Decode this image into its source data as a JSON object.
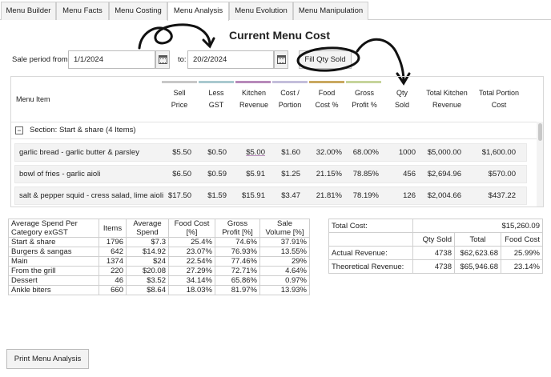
{
  "tabs": [
    {
      "label": "Menu Builder",
      "active": false
    },
    {
      "label": "Menu Facts",
      "active": false
    },
    {
      "label": "Menu Costing",
      "active": false
    },
    {
      "label": "Menu Analysis",
      "active": true
    },
    {
      "label": "Menu Evolution",
      "active": false
    },
    {
      "label": "Menu Manipulation",
      "active": false
    }
  ],
  "title": "Current Menu Cost",
  "period": {
    "label": "Sale period from:",
    "from": "1/1/2024",
    "to_label": "to:",
    "to": "20/2/2024"
  },
  "fill_button": "Fill Qty Sold",
  "grid": {
    "headers": {
      "item": "Menu Item",
      "sell_1": "Sell",
      "sell_2": "Price",
      "gst_1": "Less",
      "gst_2": "GST",
      "kitchen_1": "Kitchen",
      "kitchen_2": "Revenue",
      "cost_1": "Cost /",
      "cost_2": "Portion",
      "food_1": "Food",
      "food_2": "Cost %",
      "gross_1": "Gross",
      "gross_2": "Profit %",
      "qty_1": "Qty",
      "qty_2": "Sold",
      "tkr_1": "Total Kitchen",
      "tkr_2": "Revenue",
      "tpc_1": "Total Portion",
      "tpc_2": "Cost"
    },
    "column_colors": [
      "#c8c8c8",
      "#a9c9cf",
      "#b78aba",
      "#c3bedb",
      "#c9a860",
      "#c6d49b"
    ],
    "section": {
      "toggle": "−",
      "label": "Section: Start & share (4 Items)"
    },
    "rows": [
      {
        "item": "garlic bread - garlic butter & parsley",
        "sell": "$5.50",
        "gst": "$0.50",
        "kitchen": "$5.00",
        "cost": "$1.60",
        "food": "32.00%",
        "gross": "68.00%",
        "qty": "1000",
        "tkr": "$5,000.00",
        "tpc": "$1,600.00"
      },
      {
        "item": "bowl of fries - garlic aioli",
        "sell": "$6.50",
        "gst": "$0.59",
        "kitchen": "$5.91",
        "cost": "$1.25",
        "food": "21.15%",
        "gross": "78.85%",
        "qty": "456",
        "tkr": "$2,694.96",
        "tpc": "$570.00"
      },
      {
        "item": "salt & pepper squid - cress salad, lime aioli",
        "sell": "$17.50",
        "gst": "$1.59",
        "kitchen": "$15.91",
        "cost": "$3.47",
        "food": "21.81%",
        "gross": "78.19%",
        "qty": "126",
        "tkr": "$2,004.66",
        "tpc": "$437.22"
      }
    ]
  },
  "category_table": {
    "headers": {
      "cat_1": "Average Spend Per",
      "cat_2": "Category exGST",
      "items": "Items",
      "avg_1": "Average",
      "avg_2": "Spend",
      "fc_1": "Food Cost",
      "fc_2": "[%]",
      "gp_1": "Gross",
      "gp_2": "Profit [%]",
      "sv_1": "Sale",
      "sv_2": "Volume [%]"
    },
    "rows": [
      {
        "cat": "Start & share",
        "items": "1796",
        "avg": "$7.3",
        "fc": "25.4%",
        "gp": "74.6%",
        "sv": "37.91%"
      },
      {
        "cat": "Burgers & sangas",
        "items": "642",
        "avg": "$14.92",
        "fc": "23.07%",
        "gp": "76.93%",
        "sv": "13.55%"
      },
      {
        "cat": "Main",
        "items": "1374",
        "avg": "$24",
        "fc": "22.54%",
        "gp": "77.46%",
        "sv": "29%"
      },
      {
        "cat": "From the grill",
        "items": "220",
        "avg": "$20.08",
        "fc": "27.29%",
        "gp": "72.71%",
        "sv": "4.64%"
      },
      {
        "cat": "Dessert",
        "items": "46",
        "avg": "$3.52",
        "fc": "34.14%",
        "gp": "65.86%",
        "sv": "0.97%"
      },
      {
        "cat": "Ankle biters",
        "items": "660",
        "avg": "$8.64",
        "fc": "18.03%",
        "gp": "81.97%",
        "sv": "13.93%"
      }
    ]
  },
  "summary": {
    "total_cost_label": "Total Cost:",
    "total_cost": "$15,260.09",
    "h_qty": "Qty Sold",
    "h_total": "Total",
    "h_food": "Food Cost",
    "actual": {
      "label": "Actual Revenue:",
      "qty": "4738",
      "total": "$62,623.68",
      "food": "25.99%"
    },
    "theoretical": {
      "label": "Theoretical Revenue:",
      "qty": "4738",
      "total": "$65,946.68",
      "food": "23.14%"
    }
  },
  "print_button": "Print Menu Analysis"
}
